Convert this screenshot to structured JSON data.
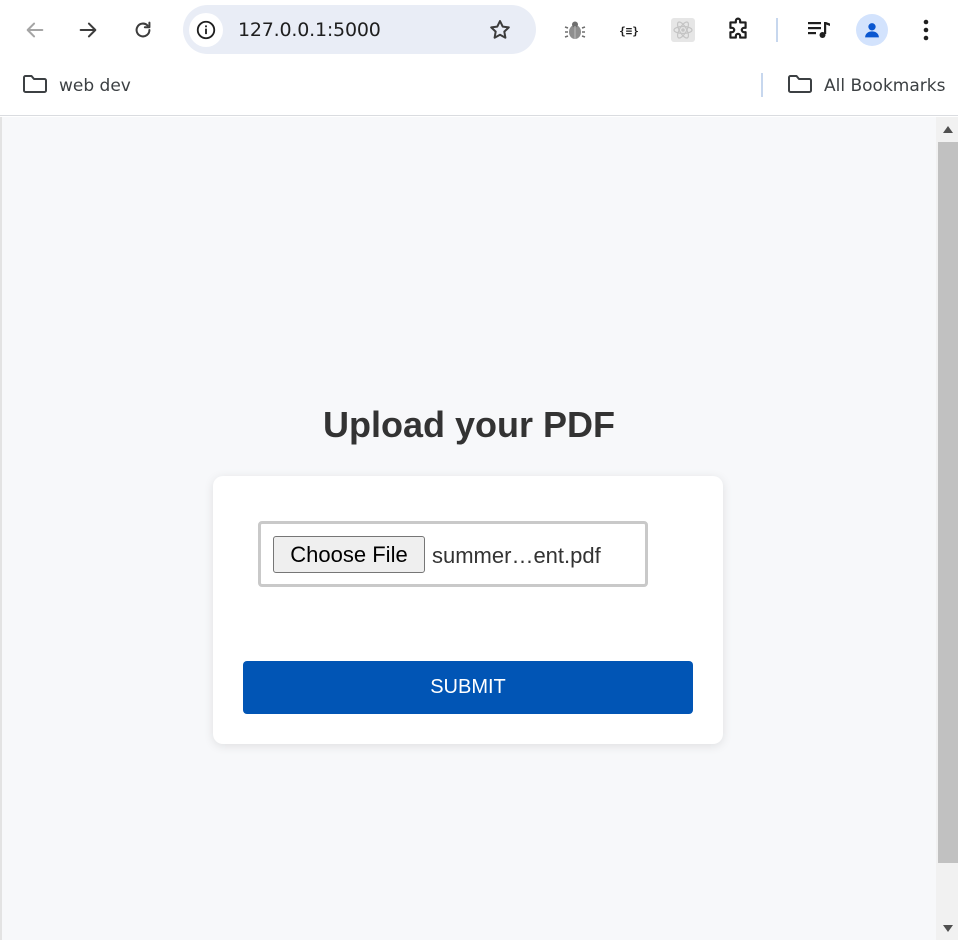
{
  "browser": {
    "url": "127.0.0.1:5000",
    "icons": {
      "back": "back-arrow-icon",
      "forward": "forward-arrow-icon",
      "reload": "reload-icon",
      "site_info": "info-icon",
      "bookmark_star": "star-icon",
      "extensions": [
        "bug-extension-icon",
        "json-extension-icon",
        "react-extension-icon",
        "puzzle-extensions-icon"
      ],
      "media": "media-controls-icon",
      "profile": "profile-avatar-icon",
      "menu": "kebab-menu-icon"
    }
  },
  "bookmarks_bar": {
    "folder": "web dev",
    "all_bookmarks": "All Bookmarks"
  },
  "page": {
    "title": "Upload your PDF",
    "file_input": {
      "button_label": "Choose File",
      "file_name": "summer…ent.pdf"
    },
    "submit_label": "SUBMIT"
  },
  "colors": {
    "primary_button": "#0155b5",
    "page_background": "#f7f8fa",
    "omnibox_background": "#e9edf6"
  }
}
